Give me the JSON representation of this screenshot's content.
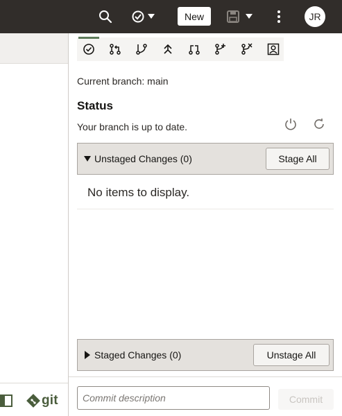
{
  "header": {
    "new_label": "New",
    "avatar_initials": "JR",
    "icons": [
      "search-icon",
      "check-circle-icon",
      "save-icon",
      "kebab-icon"
    ]
  },
  "left": {
    "git_label": "git"
  },
  "toolbar": {
    "icons": [
      "status-icon",
      "pull-request-icon",
      "branch-icon",
      "push-icon",
      "compare-icon",
      "merge-icon",
      "branch-delete-icon",
      "profile-icon"
    ]
  },
  "repo": {
    "branch_line": "Current branch: main",
    "status_title": "Status",
    "status_text": "Your branch is up to date."
  },
  "unstaged": {
    "label": "Unstaged Changes (0)",
    "button": "Stage All",
    "empty_text": "No items to display."
  },
  "staged": {
    "label": "Staged Changes (0)",
    "button": "Unstage All"
  },
  "commit": {
    "placeholder": "Commit description",
    "button": "Commit"
  },
  "colors": {
    "topbar": "#312d2a",
    "accent": "#5e7b5a",
    "section_bg": "#e4e1dd"
  }
}
